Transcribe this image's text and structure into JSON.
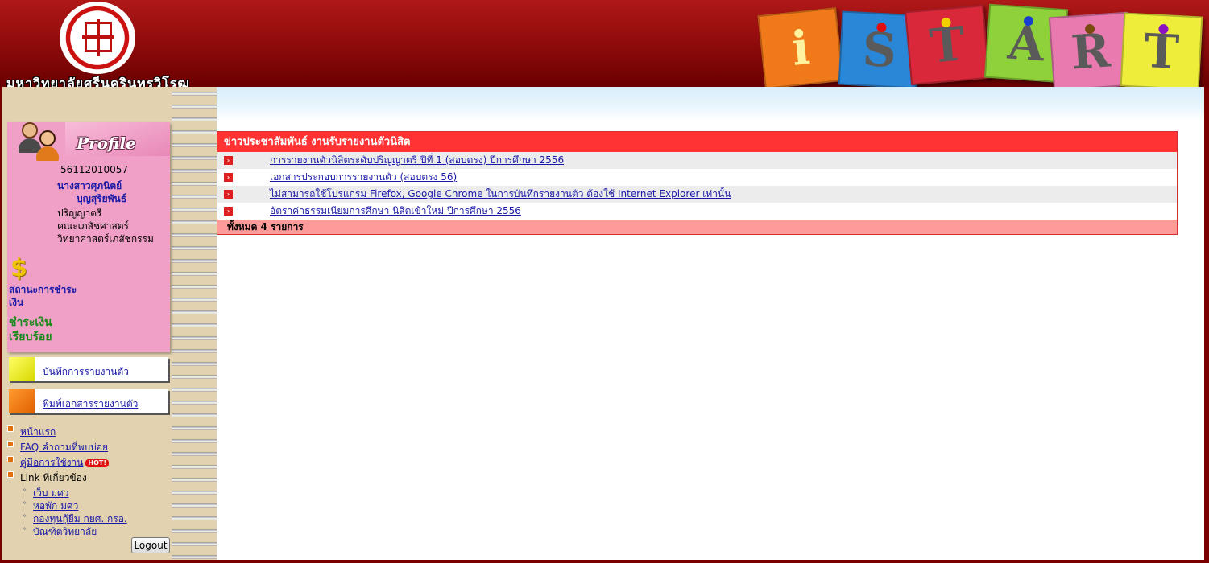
{
  "header": {
    "university_name": "มหาวิทยาลัยศรีนครินทรวิโรฒ",
    "istart_letters": [
      "i",
      "S",
      "T",
      "A",
      "R",
      "T"
    ]
  },
  "profile": {
    "title": "Profile",
    "student_id": "56112010057",
    "name_line1": "นางสาวศุภนิตย์",
    "name_line2": "บุญสุริยพันธ์",
    "degree": "ปริญญาตรี",
    "faculty": "คณะเภสัชศาสตร์",
    "program": "วิทยาศาสตร์เภสัชกรรม",
    "payment_status_label": "สถานะการชำระเงิน",
    "payment_status_value": "ชำระเงินเรียบร้อย"
  },
  "menu": {
    "record_report": "บันทึกการรายงานตัว",
    "print_documents": "พิมพ์เอกสารรายงานตัว"
  },
  "links": {
    "home": "หน้าแรก",
    "faq": "FAQ คำถามที่พบบ่อย",
    "manual": "คู่มือการใช้งาน",
    "hot_badge": "HOT!",
    "related_label": "Link ที่เกี่ยวข้อง",
    "sub": [
      "เว็บ มศว",
      "หอพัก มศว",
      "กองทุนกู้ยืม กยศ. กรอ.",
      "บัณฑิตวิทยาลัย"
    ]
  },
  "logout_label": "Logout",
  "news": {
    "header": "ข่าวประชาสัมพันธ์ งานรับรายงานตัวนิสิต",
    "items": [
      "การรายงานตัวนิสิตระดับปริญญาตรี ปีที่ 1 (สอบตรง) ปีการศึกษา 2556",
      "เอกสารประกอบการรายงานตัว (สอบตรง 56)",
      "ไม่สามารถใช้โปรแกรม Firefox, Google Chrome ในการบันทึกรายงานตัว ต้องใช้ Internet Explorer เท่านั้น",
      "อัตราค่าธรรมเนียมการศึกษา นิสิตเข้าใหม่ ปีการศึกษา 2556"
    ],
    "footer": "ทั้งหมด 4 รายการ"
  },
  "colors": {
    "header_red": "#8c0a0a",
    "news_header": "#ff3333",
    "news_footer": "#ff9a9a",
    "profile_pink": "#f0a0c6",
    "link_blue": "#1a1aa8",
    "paid_green": "#1a8a1a"
  },
  "icons": [
    "university-seal-icon",
    "user-pair-icon",
    "dollar-icon",
    "red-arrow-bullet-icon",
    "orange-square-bullet-icon"
  ]
}
